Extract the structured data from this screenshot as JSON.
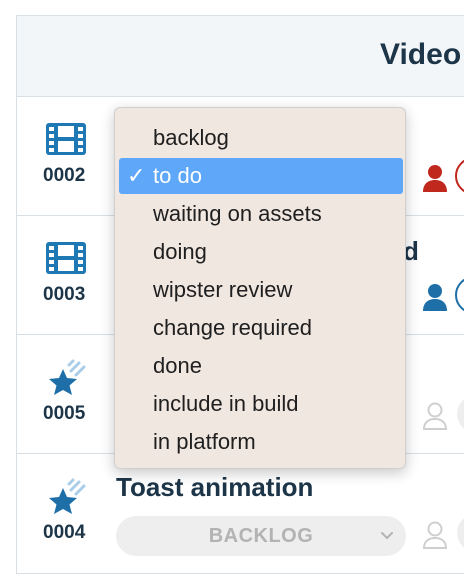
{
  "header": {
    "title": "Video"
  },
  "rows": [
    {
      "id": "0002",
      "type_icon": "film-icon",
      "title": "",
      "status": "",
      "user_icon": "user-icon",
      "user_color": "#c0281e",
      "avatar_color": "#c0281e"
    },
    {
      "id": "0003",
      "type_icon": "film-icon",
      "title": "d",
      "status": "",
      "user_icon": "user-icon",
      "user_color": "#1e6fa8",
      "avatar_color": "#1e6fa8"
    },
    {
      "id": "0005",
      "type_icon": "shooting-star-icon",
      "title": "",
      "status": "",
      "user_icon": "user-outline-icon",
      "user_color": "#cfcfcf",
      "avatar_color": ""
    },
    {
      "id": "0004",
      "type_icon": "shooting-star-icon",
      "title": "Toast animation",
      "status": "BACKLOG",
      "user_icon": "user-outline-icon",
      "user_color": "#cfcfcf",
      "avatar_color": ""
    }
  ],
  "dropdown": {
    "selected_index": 1,
    "check_mark": "✓",
    "options": [
      "backlog",
      "to do",
      "waiting on assets",
      "doing",
      "wipster review",
      "change required",
      "done",
      "include in build",
      "in platform"
    ]
  },
  "colors": {
    "brand_dark": "#1d3548",
    "film_blue": "#1e78b4",
    "star_blue": "#1e6fa8",
    "selected_blue": "#5ea7f9",
    "menu_bg": "#f1e7e1"
  }
}
